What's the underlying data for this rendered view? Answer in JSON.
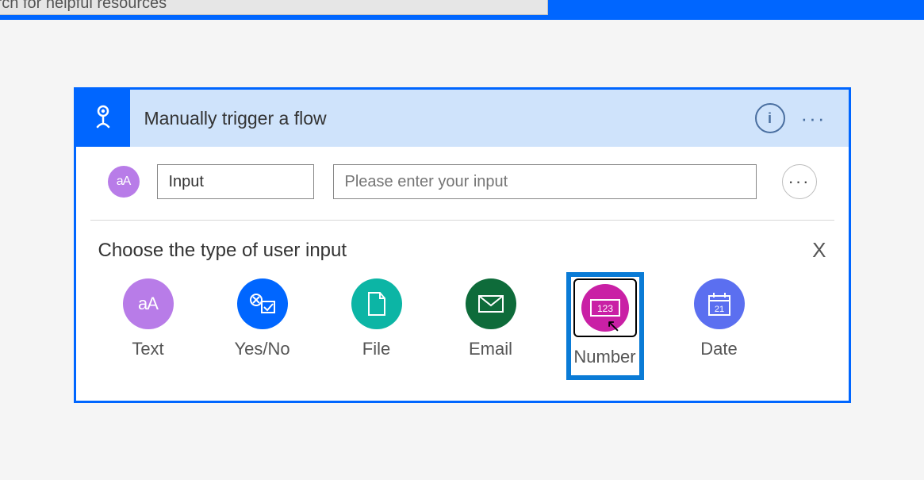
{
  "search": {
    "placeholder": "Search for helpful resources"
  },
  "trigger": {
    "title": "Manually trigger a flow",
    "info_tooltip": "i",
    "more": "···"
  },
  "input_row": {
    "badge_text": "aA",
    "name_field": "Input",
    "desc_placeholder": "Please enter your input",
    "more": "···"
  },
  "choose": {
    "title": "Choose the type of user input",
    "close": "X"
  },
  "types": [
    {
      "id": "text",
      "label": "Text"
    },
    {
      "id": "yesno",
      "label": "Yes/No"
    },
    {
      "id": "file",
      "label": "File"
    },
    {
      "id": "email",
      "label": "Email"
    },
    {
      "id": "number",
      "label": "Number"
    },
    {
      "id": "date",
      "label": "Date"
    }
  ],
  "badge_123": "123",
  "date_badge_day": "21"
}
